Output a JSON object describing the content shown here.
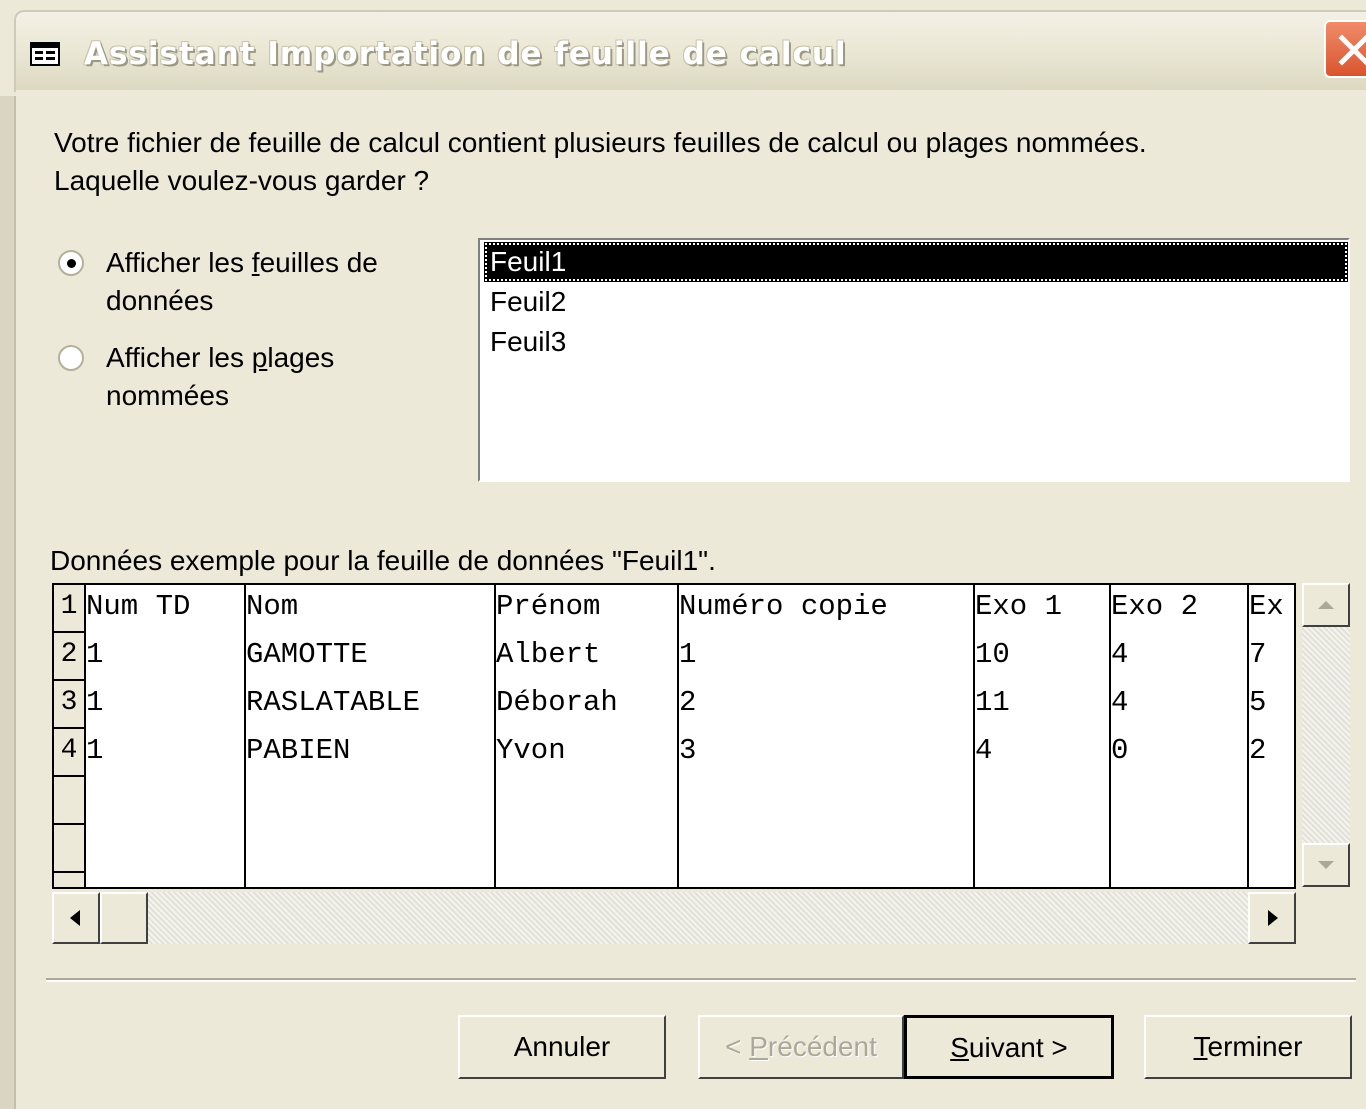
{
  "window": {
    "title": "Assistant Importation de feuille de calcul"
  },
  "intro": {
    "line1": "Votre fichier de feuille de calcul contient plusieurs feuilles de calcul ou plages nommées.",
    "line2": "Laquelle voulez-vous garder ?"
  },
  "options": [
    {
      "label_line1_pre": "Afficher les ",
      "label_line1_mnemonic": "f",
      "label_line1_post": "euilles de",
      "label_line2": "données",
      "selected": true
    },
    {
      "label_line1_pre": "Afficher les ",
      "label_line1_mnemonic": "p",
      "label_line1_post": "lages",
      "label_line2": "nommées",
      "selected": false
    }
  ],
  "sheets": [
    "Feuil1",
    "Feuil2",
    "Feuil3"
  ],
  "selected_sheet": "Feuil1",
  "preview": {
    "caption": "Données exemple pour la feuille de données \"Feuil1\".",
    "row_numbers": [
      "1",
      "2",
      "3",
      "4"
    ],
    "rows": [
      [
        "Num TD",
        "Nom",
        "Prénom",
        "Numéro copie",
        "Exo 1",
        "Exo 2",
        "Ex"
      ],
      [
        "1",
        "GAMOTTE",
        "Albert",
        "1",
        "10",
        "4",
        "7"
      ],
      [
        "1",
        "RASLATABLE",
        "Déborah",
        "2",
        "11",
        "4",
        "5"
      ],
      [
        "1",
        "PABIEN",
        "Yvon",
        "3",
        "4",
        "0",
        "2"
      ]
    ]
  },
  "buttons": {
    "cancel": "Annuler",
    "previous_pre": "< ",
    "previous_mnemonic": "P",
    "previous_post": "récédent",
    "next_mnemonic": "S",
    "next_post": "uivant >",
    "finish_mnemonic": "T",
    "finish_post": "erminer"
  }
}
